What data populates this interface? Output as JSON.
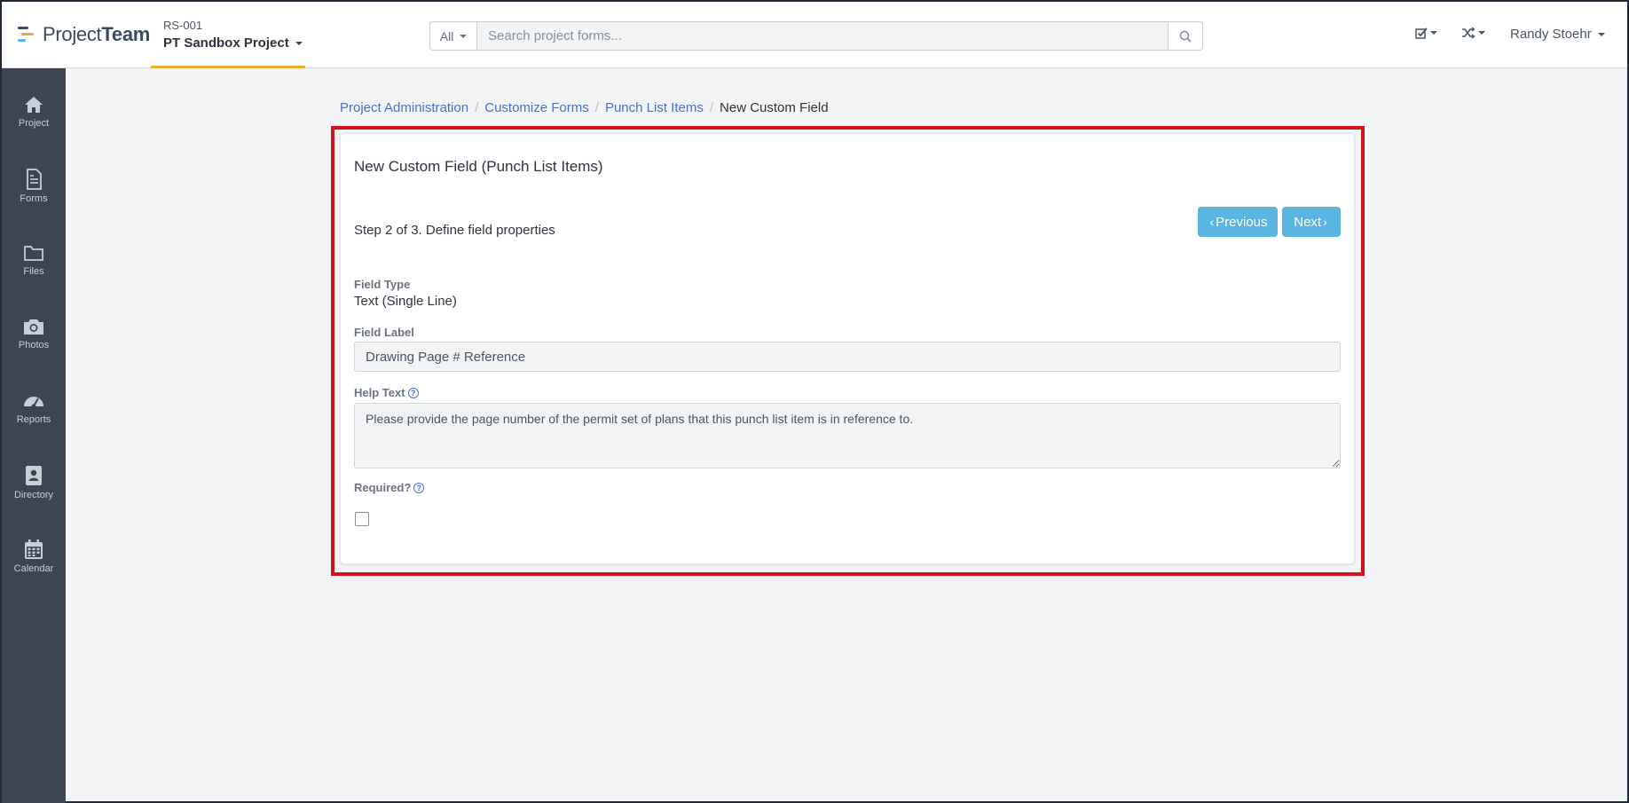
{
  "topbar": {
    "logo": {
      "part1": "Project",
      "part2": "Team"
    },
    "project": {
      "code": "RS-001",
      "name": "PT Sandbox Project"
    },
    "search": {
      "scope": "All",
      "placeholder": "Search project forms..."
    },
    "user": {
      "name": "Randy Stoehr"
    }
  },
  "sidebar": {
    "items": [
      {
        "label": "Project",
        "icon": "home-icon"
      },
      {
        "label": "Forms",
        "icon": "document-icon"
      },
      {
        "label": "Files",
        "icon": "folder-icon"
      },
      {
        "label": "Photos",
        "icon": "camera-icon"
      },
      {
        "label": "Reports",
        "icon": "gauge-icon"
      },
      {
        "label": "Directory",
        "icon": "contact-book-icon"
      },
      {
        "label": "Calendar",
        "icon": "calendar-icon"
      }
    ]
  },
  "breadcrumb": [
    "Project Administration",
    "Customize Forms",
    "Punch List Items",
    "New Custom Field"
  ],
  "form": {
    "title": "New Custom Field (Punch List Items)",
    "step": "Step 2 of 3. Define field properties",
    "prev_label": "Previous",
    "next_label": "Next",
    "field_type_label": "Field Type",
    "field_type_value": "Text (Single Line)",
    "field_label_label": "Field Label",
    "field_label_value": "Drawing Page # Reference",
    "help_text_label": "Help Text",
    "help_text_value": "Please provide the page number of the permit set of plans that this punch list item is in reference to.",
    "required_label": "Required?",
    "required_checked": false
  },
  "colors": {
    "accent": "#5bb5e1",
    "link": "#4a6fd1",
    "sidebar": "#3d4552",
    "highlight": "#d4121b",
    "tab_underline": "#f0ad2b"
  }
}
